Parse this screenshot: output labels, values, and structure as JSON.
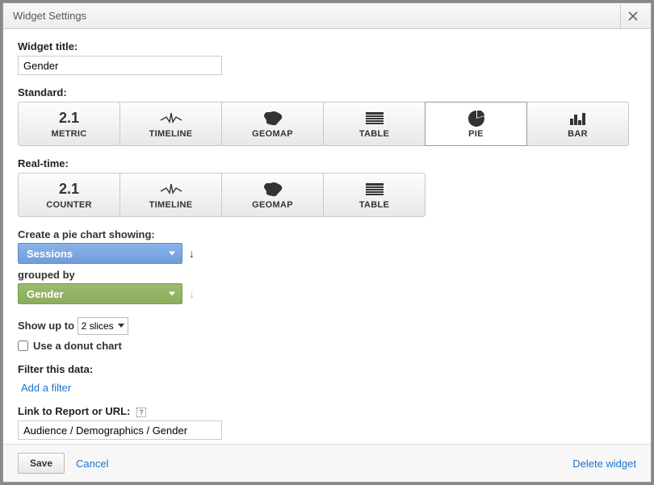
{
  "modal": {
    "title": "Widget Settings"
  },
  "widgetTitle": {
    "label": "Widget title:",
    "value": "Gender"
  },
  "standard": {
    "label": "Standard:",
    "tiles": [
      {
        "id": "metric",
        "label": "METRIC",
        "num": "2.1"
      },
      {
        "id": "timeline",
        "label": "TIMELINE"
      },
      {
        "id": "geomap",
        "label": "GEOMAP"
      },
      {
        "id": "table",
        "label": "TABLE"
      },
      {
        "id": "pie",
        "label": "PIE",
        "selected": true
      },
      {
        "id": "bar",
        "label": "BAR"
      }
    ]
  },
  "realtime": {
    "label": "Real-time:",
    "tiles": [
      {
        "id": "counter",
        "label": "COUNTER",
        "num": "2.1"
      },
      {
        "id": "timeline",
        "label": "TIMELINE"
      },
      {
        "id": "geomap",
        "label": "GEOMAP"
      },
      {
        "id": "table",
        "label": "TABLE"
      }
    ]
  },
  "pie": {
    "metricLabel": "Create a pie chart showing:",
    "metricValue": "Sessions",
    "groupByLabel": "grouped by",
    "groupByValue": "Gender",
    "showUpToLabel": "Show up to",
    "slicesValue": "2 slices",
    "donutLabel": "Use a donut chart",
    "donutChecked": false
  },
  "filter": {
    "label": "Filter this data:",
    "addLink": "Add a filter"
  },
  "linkTo": {
    "label": "Link to Report or URL:",
    "value": "Audience / Demographics / Gender"
  },
  "footer": {
    "save": "Save",
    "cancel": "Cancel",
    "delete": "Delete widget"
  }
}
